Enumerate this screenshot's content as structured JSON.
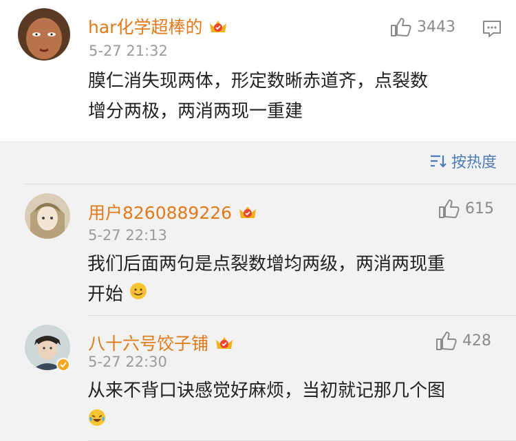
{
  "main_comment": {
    "username": "har化学超棒的",
    "timestamp": "5-27 21:32",
    "text_line1": "膜仁消失现两体，形定数晰赤道齐，点裂数",
    "text_line2": "增分两极，两消两现一重建",
    "likes": "3443"
  },
  "sort": {
    "label": "按热度"
  },
  "replies": [
    {
      "username": "用户8260889226",
      "timestamp": "5-27 22:13",
      "text_line1": "我们后面两句是点裂数增均两级，两消两现重",
      "text_line2": "开始",
      "likes": "615",
      "emoji": "smile-emoji"
    },
    {
      "username": "八十六号饺子铺",
      "timestamp": "5-27 22:30",
      "text_line1": "从来不背口诀感觉好麻烦，当初就记那几个图",
      "likes": "428",
      "emoji": "laugh-cry-emoji"
    }
  ],
  "colors": {
    "username": "#e07a1a",
    "link": "#4c7bb8",
    "timestamp": "#9a9a9a",
    "background": "#f2f2f2"
  }
}
